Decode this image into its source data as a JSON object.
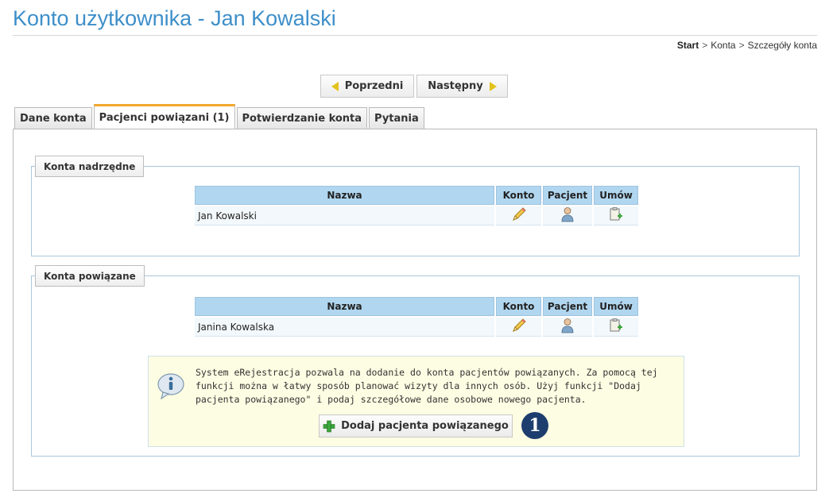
{
  "page": {
    "title": "Konto użytkownika - Jan Kowalski"
  },
  "breadcrumb": {
    "items": [
      "Start",
      "Konta",
      "Szczegóły konta"
    ],
    "separator": ">"
  },
  "nav": {
    "prev_label": "Poprzedni",
    "next_label": "Następny"
  },
  "tabs": [
    {
      "label": "Dane konta",
      "active": false
    },
    {
      "label": "Pacjenci powiązani (1)",
      "active": true
    },
    {
      "label": "Potwierdzanie konta",
      "active": false
    },
    {
      "label": "Pytania",
      "active": false
    }
  ],
  "parent_accounts": {
    "legend": "Konta nadrzędne",
    "columns": [
      "Nazwa",
      "Konto",
      "Pacjent",
      "Umów"
    ],
    "rows": [
      {
        "name": "Jan Kowalski",
        "icons": [
          "pencil-icon",
          "patient-icon",
          "appointment-add-icon"
        ]
      }
    ]
  },
  "linked_accounts": {
    "legend": "Konta powiązane",
    "columns": [
      "Nazwa",
      "Konto",
      "Pacjent",
      "Umów"
    ],
    "rows": [
      {
        "name": "Janina Kowalska",
        "icons": [
          "pencil-icon",
          "patient-icon",
          "appointment-add-icon"
        ]
      }
    ],
    "info": {
      "text": "System eRejestracja pozwala na dodanie do konta pacjentów powiązanych. Za pomocą tej funkcji można w łatwy sposób planować wizyty dla innych osób. Użyj funkcji \"Dodaj pacjenta powiązanego\" i podaj szczegółowe dane osobowe nowego pacjenta.",
      "button_label": "Dodaj pacjenta powiązanego",
      "step_badge": "1"
    }
  },
  "colors": {
    "title": "#3d8fc9",
    "tab_active_accent": "#f2a82c",
    "table_header": "#b1d6ef",
    "info_bg": "#fdfde3",
    "badge": "#1d3d6e"
  }
}
